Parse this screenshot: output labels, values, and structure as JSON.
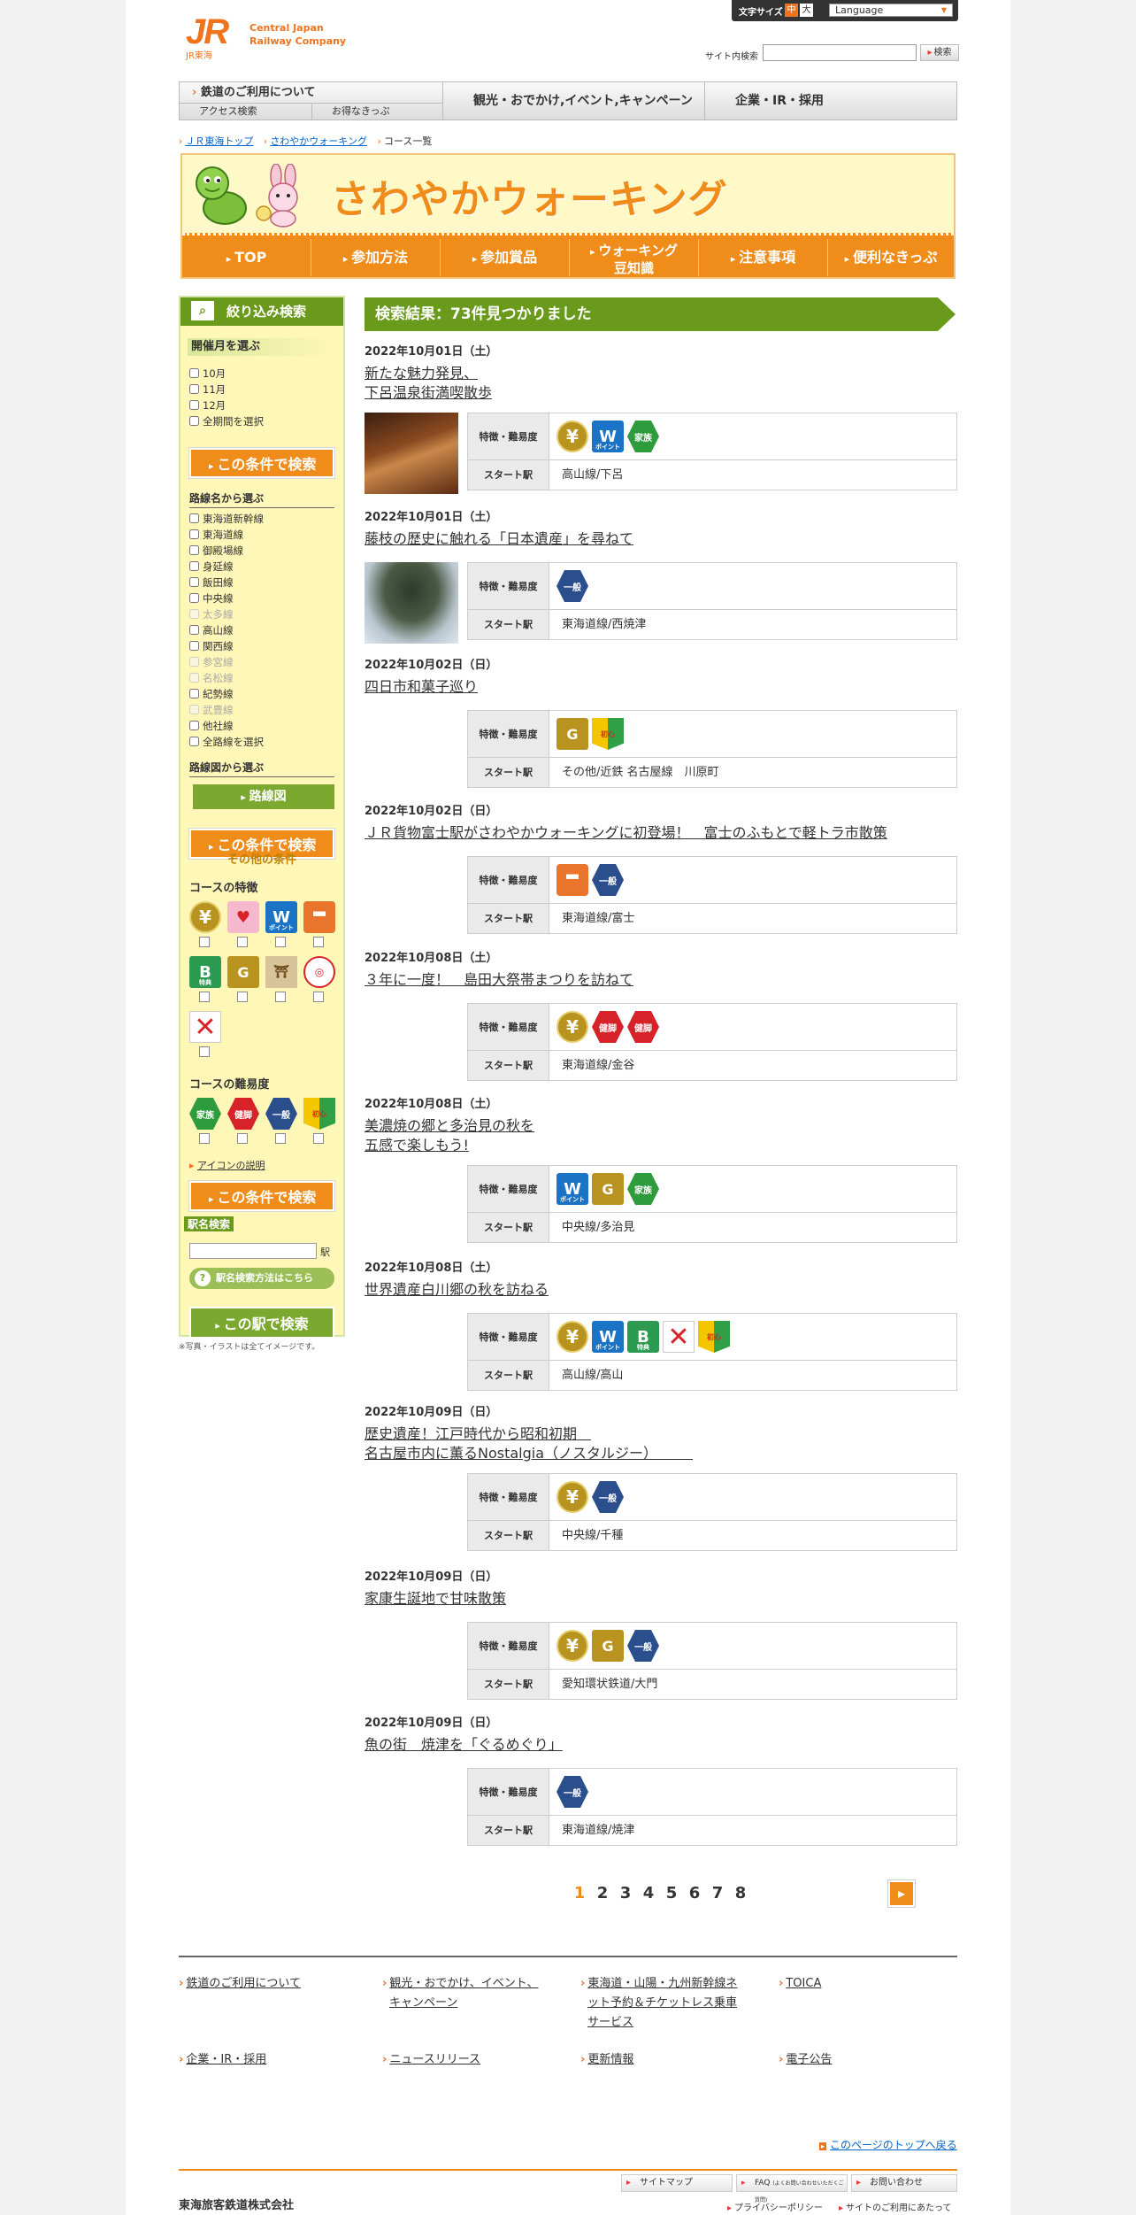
{
  "header": {
    "logo_jr": "JR",
    "logo_sub": "JR東海",
    "logo_company_line1": "Central Japan",
    "logo_company_line2": "Railway Company",
    "font_size_label": "文字サイズ",
    "font_size_medium": "中",
    "font_size_large": "大",
    "language": "Language",
    "site_search_label": "サイト内検索",
    "site_search_button": "検索"
  },
  "global_nav": {
    "railway_use": "鉄道のご利用について",
    "access_search": "アクセス検索",
    "discount_tickets": "お得なきっぷ",
    "tourism": "観光・おでかけ,イベント,キャンペーン",
    "corporate": "企業・IR・採用"
  },
  "breadcrumb": [
    "ＪＲ東海トップ",
    "さわやかウォーキング",
    "コース一覧"
  ],
  "banner": {
    "title": "さわやかウォーキング",
    "nav": [
      "TOP",
      "参加方法",
      "参加賞品",
      "ウォーキング",
      "豆知識",
      "注意事項",
      "便利なきっぷ"
    ]
  },
  "sidebar": {
    "refine_title": "絞り込み検索",
    "month_title": "開催月を選ぶ",
    "months": [
      "10月",
      "11月",
      "12月",
      "全期間を選択"
    ],
    "search_button": "この条件で検索",
    "line_title": "路線名から選ぶ",
    "lines": [
      "東海道新幹線",
      "東海道線",
      "御殿場線",
      "身延線",
      "飯田線",
      "中央線",
      "太多線",
      "高山線",
      "関西線",
      "参宮線",
      "名松線",
      "紀勢線",
      "武豊線",
      "他社線",
      "全路線を選択"
    ],
    "map_title": "路線図から選ぶ",
    "map_button": "路線図",
    "other_conditions": "その他の条件",
    "features_title": "コースの特徴",
    "difficulty_title": "コースの難易度",
    "icon_help": "アイコンの説明",
    "station_search_title": "駅名検索",
    "station_suffix": "駅",
    "station_help": "駅名検索方法はこちら",
    "station_button": "この駅で検索",
    "photo_note": "※写真・イラストは全てイメージです。",
    "feature_icons": [
      "yen-icon",
      "heart-icon",
      "w-point-icon",
      "train-icon",
      "b-tokuten-icon",
      "gourmet-icon",
      "history-icon",
      "stamp-icon",
      "no-icon"
    ],
    "difficulty_icons": [
      "family-icon",
      "kenkyaku-icon",
      "ippan-icon",
      "shoshinsha-icon"
    ]
  },
  "results": {
    "heading": "検索結果：73件見つかりました",
    "feature_label": "特徴・難易度",
    "station_label": "スタート駅",
    "items": [
      {
        "date": "2022年10月01日（土）",
        "name1": "新たな魅力発見、",
        "name2": "下呂温泉街満喫散歩",
        "station": "高山線/下呂",
        "icons": [
          "yen",
          "wpoint",
          "family"
        ],
        "photo": true
      },
      {
        "date": "2022年10月01日（土）",
        "name1": "藤枝の歴史に触れる「日本遺産」を尋ねて",
        "name2": "",
        "station": "東海道線/西焼津",
        "icons": [
          "ippan"
        ],
        "photo": true
      },
      {
        "date": "2022年10月02日（日）",
        "name1": "四日市和菓子巡り",
        "name2": "",
        "station": "その他/近鉄 名古屋線　川原町",
        "icons": [
          "gourmet",
          "shoshin"
        ],
        "photo": false
      },
      {
        "date": "2022年10月02日（日）",
        "name1": "ＪＲ貨物富士駅がさわやかウォーキングに初登場！　富士のふもとで軽トラ市散策",
        "name2": "",
        "station": "東海道線/富士",
        "icons": [
          "train",
          "ippan"
        ],
        "photo": false
      },
      {
        "date": "2022年10月08日（土）",
        "name1": "３年に一度！　島田大祭帯まつりを訪ねて",
        "name2": "",
        "station": "東海道線/金谷",
        "icons": [
          "yen",
          "kenkyaku",
          "kenkyaku"
        ],
        "photo": false
      },
      {
        "date": "2022年10月08日（土）",
        "name1": "美濃焼の郷と多治見の秋を",
        "name2": "五感で楽しもう!",
        "station": "中央線/多治見",
        "icons": [
          "wpoint",
          "gourmet",
          "family"
        ],
        "photo": false
      },
      {
        "date": "2022年10月08日（土）",
        "name1": "世界遺産白川郷の秋を訪ねる",
        "name2": "",
        "station": "高山線/高山",
        "icons": [
          "yen",
          "wpoint",
          "btoku",
          "noicon",
          "shoshin"
        ],
        "photo": false
      },
      {
        "date": "2022年10月09日（日）",
        "name1": "歴史遺産！江戸時代から昭和初期　",
        "name2": "名古屋市内に薫るNostalgia（ノスタルジー）　　　",
        "station": "中央線/千種",
        "icons": [
          "yen",
          "ippan"
        ],
        "photo": false
      },
      {
        "date": "2022年10月09日（日）",
        "name1": "家康生誕地で甘味散策",
        "name2": "",
        "station": "愛知環状鉄道/大門",
        "icons": [
          "yen",
          "gourmet",
          "ippan"
        ],
        "photo": false
      },
      {
        "date": "2022年10月09日（日）",
        "name1": "魚の街　焼津を「ぐるめぐり」",
        "name2": "",
        "station": "東海道線/焼津",
        "icons": [
          "ippan"
        ],
        "photo": false
      }
    ]
  },
  "pager": {
    "pages": [
      "1",
      "2",
      "3",
      "4",
      "5",
      "6",
      "7",
      "8"
    ],
    "current": "1",
    "next": "▸"
  },
  "footer": {
    "links": [
      "鉄道のご利用について",
      "観光・おでかけ、イベント、",
      "キャンペーン",
      "東海道・山陽・九州新幹線ネ",
      "ット予約＆チケットレス乗車",
      "サービス",
      "TOICA",
      "企業・IR・採用",
      "ニュースリリース",
      "更新情報",
      "電子公告"
    ],
    "to_top": "このページのトップへ戻る",
    "sitemap": "サイトマップ",
    "faq": "FAQ",
    "faq_sub": "(よくお問い合わせいただくご質問)",
    "contact": "お問い合わせ",
    "corp_name": "東海旅客鉄道株式会社",
    "privacy": "プライバシーポリシー",
    "site_use": "サイトのご利用にあたって"
  },
  "colors": {
    "accent_orange": "#f08c1a",
    "accent_green": "#6a9a1c",
    "jr_orange": "#f0731e"
  }
}
